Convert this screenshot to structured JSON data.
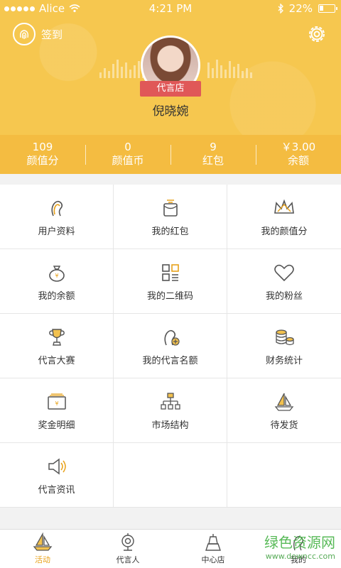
{
  "statusbar": {
    "carrier": "Alice",
    "time": "4:21 PM",
    "battery": "22%"
  },
  "header": {
    "signin_label": "签到",
    "badge_label": "代言店",
    "username": "倪晓婉"
  },
  "stats": [
    {
      "value": "109",
      "label": "颜值分"
    },
    {
      "value": "0",
      "label": "颜值币"
    },
    {
      "value": "9",
      "label": "红包"
    },
    {
      "value": "￥3.00",
      "label": "余额"
    }
  ],
  "grid": [
    {
      "label": "用户资料",
      "icon": "user-profile-icon"
    },
    {
      "label": "我的红包",
      "icon": "red-envelope-icon"
    },
    {
      "label": "我的颜值分",
      "icon": "crown-icon"
    },
    {
      "label": "我的余额",
      "icon": "money-bag-icon"
    },
    {
      "label": "我的二维码",
      "icon": "qr-code-icon"
    },
    {
      "label": "我的粉丝",
      "icon": "heart-icon"
    },
    {
      "label": "代言大赛",
      "icon": "trophy-icon"
    },
    {
      "label": "我的代言名额",
      "icon": "endorse-quota-icon"
    },
    {
      "label": "财务统计",
      "icon": "coins-icon"
    },
    {
      "label": "奖金明细",
      "icon": "bonus-card-icon"
    },
    {
      "label": "市场结构",
      "icon": "org-chart-icon"
    },
    {
      "label": "待发货",
      "icon": "sailboat-icon"
    },
    {
      "label": "代言资讯",
      "icon": "megaphone-icon"
    }
  ],
  "tabs": [
    {
      "label": "活动",
      "icon": "sailboat-tab-icon",
      "active": true
    },
    {
      "label": "代言人",
      "icon": "camera-tab-icon",
      "active": false
    },
    {
      "label": "中心店",
      "icon": "tower-tab-icon",
      "active": false
    },
    {
      "label": "我的",
      "icon": "person-tab-icon",
      "active": false
    }
  ],
  "watermark": {
    "text": "绿色资源网",
    "url": "www.downcc.com"
  },
  "colors": {
    "header": "#f6c74f",
    "stats": "#f4bc41",
    "accent": "#e8a21a",
    "ribbon": "#e05858"
  }
}
